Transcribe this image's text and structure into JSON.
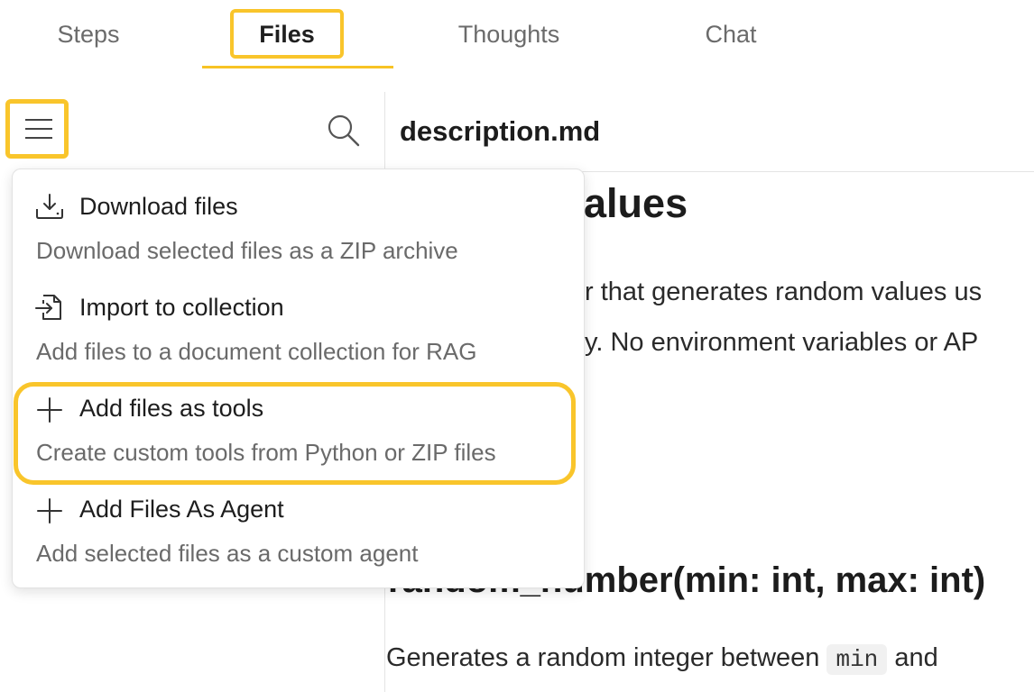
{
  "tabs": [
    {
      "label": "Steps",
      "active": false
    },
    {
      "label": "Files",
      "active": true
    },
    {
      "label": "Thoughts",
      "active": false
    },
    {
      "label": "Chat",
      "active": false
    }
  ],
  "file_panel": {
    "open_file_title": "description.md",
    "menu_icon": "hamburger-menu-icon",
    "search_icon": "search-icon"
  },
  "document": {
    "heading_visible": "values",
    "para1_visible": "r that generates random values us",
    "para2_visible": "y. No environment variables or AP",
    "heading2_visible": "random_number(min: int, max: int)",
    "para3_prefix": "Generates a random integer between ",
    "para3_code": "min",
    "para3_suffix": " and"
  },
  "dropdown_menu": {
    "items": [
      {
        "title": "Download files",
        "description": "Download selected files as a ZIP archive",
        "icon": "download-tray-icon"
      },
      {
        "title": "Import to collection",
        "description": "Add files to a document collection for RAG",
        "icon": "import-file-icon"
      },
      {
        "title": "Add files as tools",
        "description": "Create custom tools from Python or ZIP files",
        "icon": "plus-icon"
      },
      {
        "title": "Add Files As Agent",
        "description": "Add selected files as a custom agent",
        "icon": "plus-icon"
      }
    ]
  },
  "colors": {
    "highlight": "#f9c52b",
    "tab_underline": "#f7c325",
    "muted_text": "#6a6a6a"
  }
}
